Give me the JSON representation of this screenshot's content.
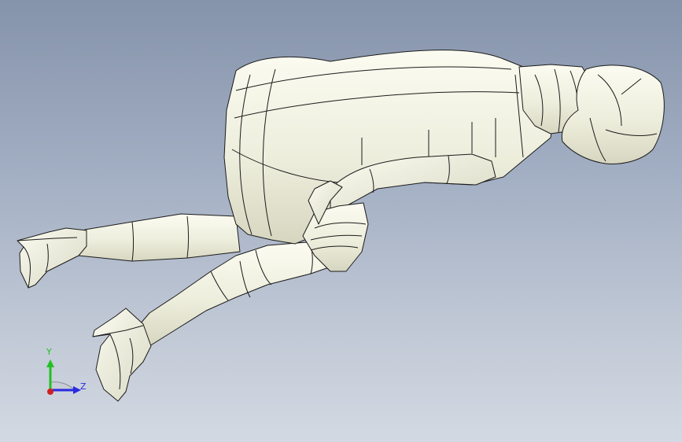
{
  "viewport": {
    "background_top": "#8593ab",
    "background_bottom": "#d3d9e2",
    "model": {
      "name": "reclining-figure-surface-model",
      "surface_color": "#f1f1e3",
      "edge_color": "#1b1b1b"
    }
  },
  "triad": {
    "y_label": "Y",
    "z_label": "Z",
    "y_color": "#22c022",
    "z_color": "#2a2ae0",
    "x_color": "#d02020"
  }
}
